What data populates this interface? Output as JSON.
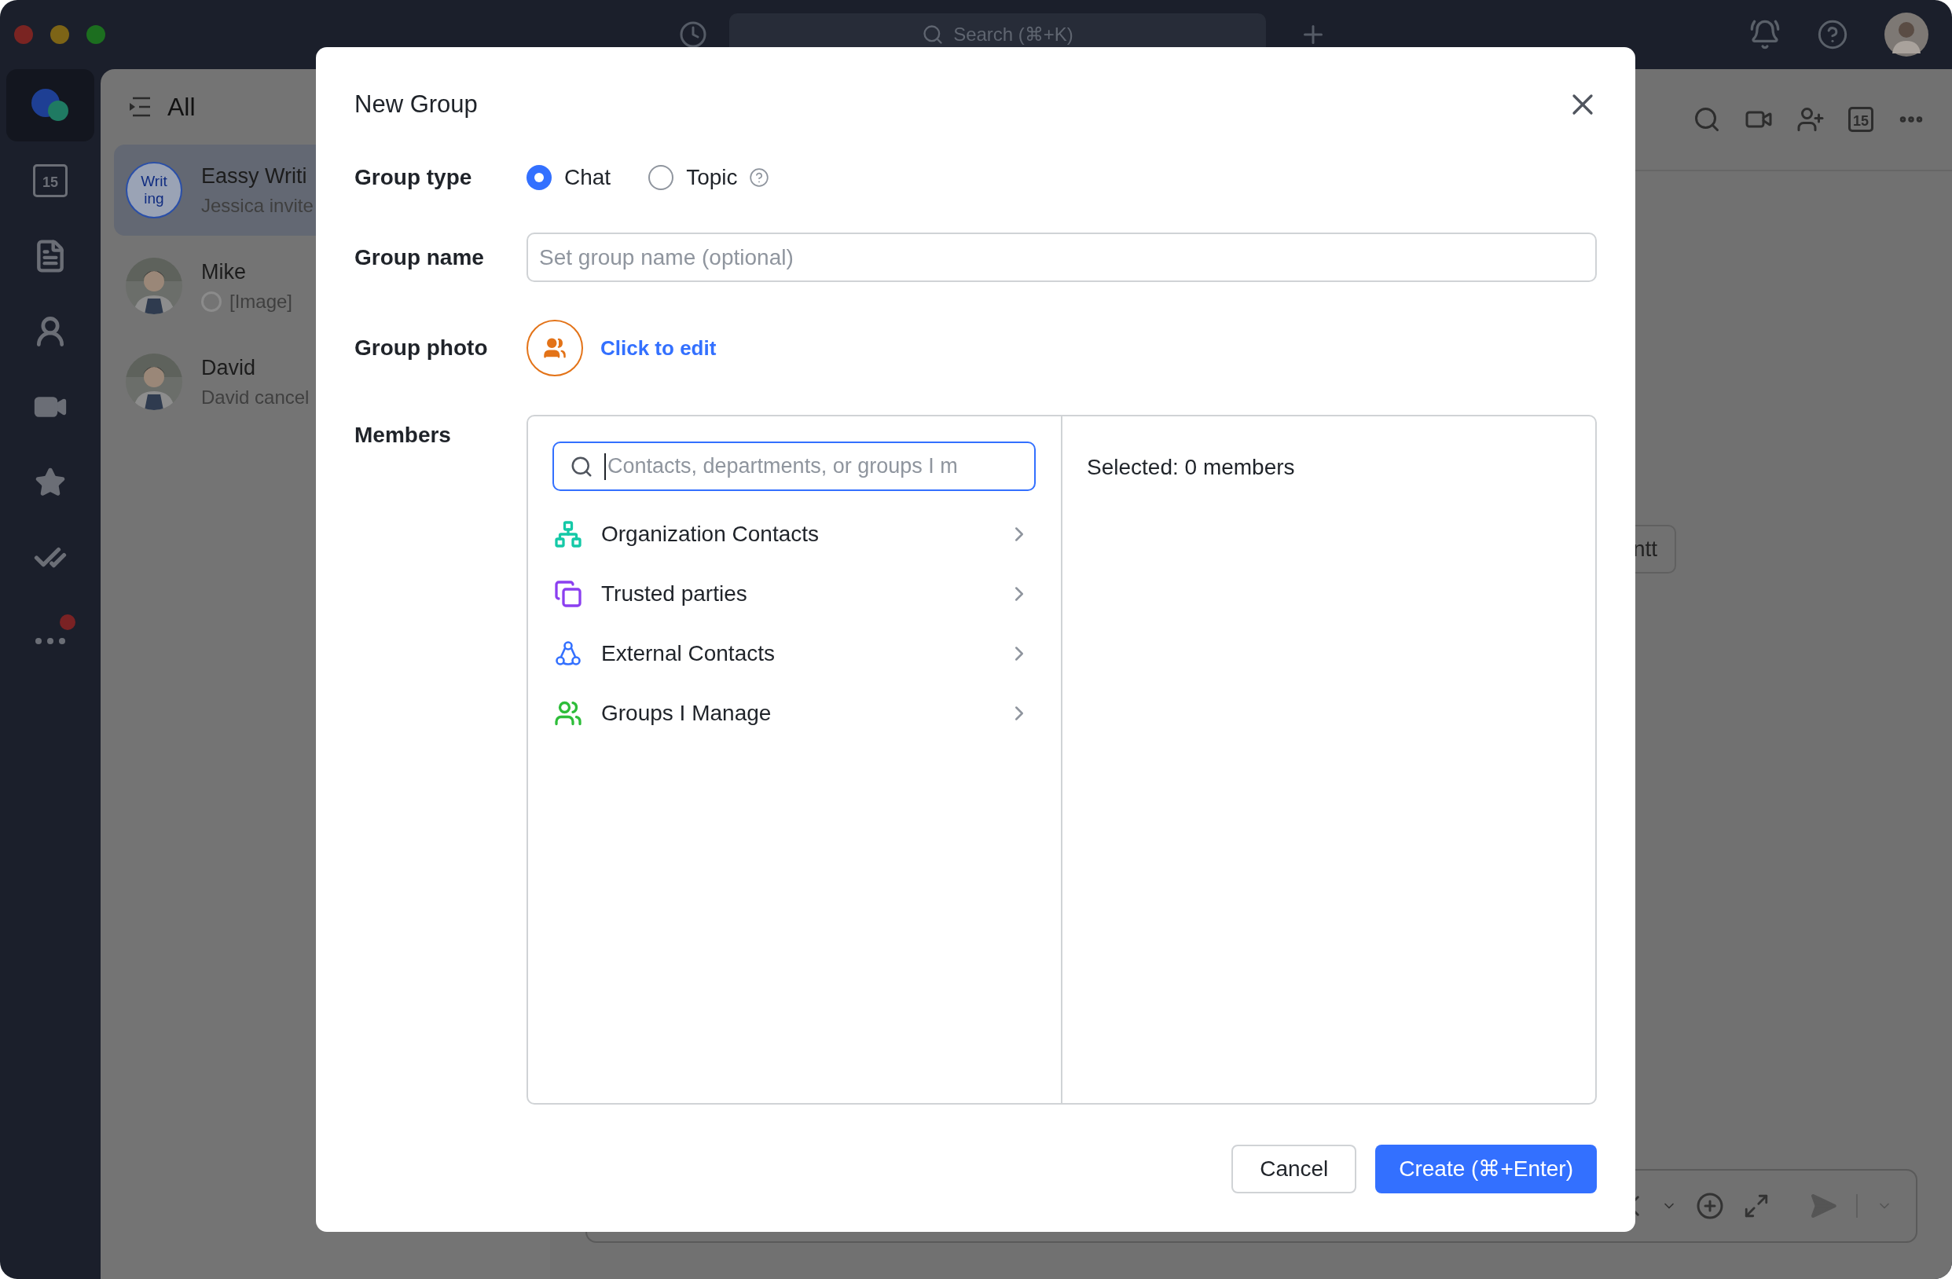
{
  "window": {
    "search": {
      "placeholder": "Search (⌘+K)"
    }
  },
  "rail": {
    "items": [
      {
        "kind": "messages",
        "selected": true,
        "badge": false
      },
      {
        "kind": "calendar",
        "selected": false,
        "badge": false,
        "label": "15"
      },
      {
        "kind": "docs",
        "selected": false,
        "badge": false
      },
      {
        "kind": "contacts",
        "selected": false,
        "badge": false
      },
      {
        "kind": "video",
        "selected": false,
        "badge": false
      },
      {
        "kind": "favorites",
        "selected": false,
        "badge": false
      },
      {
        "kind": "tasks",
        "selected": false,
        "badge": false
      },
      {
        "kind": "more",
        "selected": false,
        "badge": true
      }
    ]
  },
  "chat_list": {
    "title": "All",
    "items": [
      {
        "name": "Eassy Writi",
        "preview": "Jessica invite",
        "avatar": {
          "kind": "initials",
          "lines": [
            "Writ",
            "ing"
          ]
        },
        "selected": true,
        "pending": false
      },
      {
        "name": "Mike",
        "preview": "[Image]",
        "selected": false,
        "pending": true
      },
      {
        "name": "David",
        "preview": "David cancel",
        "selected": false,
        "pending": false
      }
    ]
  },
  "chat": {
    "header_calendar_label": "15",
    "side_button": "ntt"
  },
  "dialog": {
    "title": "New Group",
    "group_type": {
      "label": "Group type",
      "options": [
        {
          "label": "Chat",
          "selected": true,
          "help": false
        },
        {
          "label": "Topic",
          "selected": false,
          "help": true
        }
      ]
    },
    "group_name": {
      "label": "Group name",
      "placeholder": "Set group name (optional)"
    },
    "group_photo": {
      "label": "Group photo",
      "action": "Click to edit"
    },
    "members": {
      "label": "Members",
      "search": {
        "placeholder": "Contacts, departments, or groups I m",
        "focused": true
      },
      "sources": [
        {
          "kind": "organization",
          "label": "Organization Contacts",
          "color": "#14c9a7"
        },
        {
          "kind": "trusted",
          "label": "Trusted parties",
          "color": "#8b3ff0"
        },
        {
          "kind": "external",
          "label": "External Contacts",
          "color": "#3370ff"
        },
        {
          "kind": "groups",
          "label": "Groups I Manage",
          "color": "#2ebd3a"
        }
      ],
      "selected_summary": "Selected: 0 members"
    },
    "buttons": [
      {
        "label": "Cancel",
        "kind": "secondary"
      },
      {
        "label": "Create (⌘+Enter)",
        "kind": "primary"
      }
    ]
  }
}
